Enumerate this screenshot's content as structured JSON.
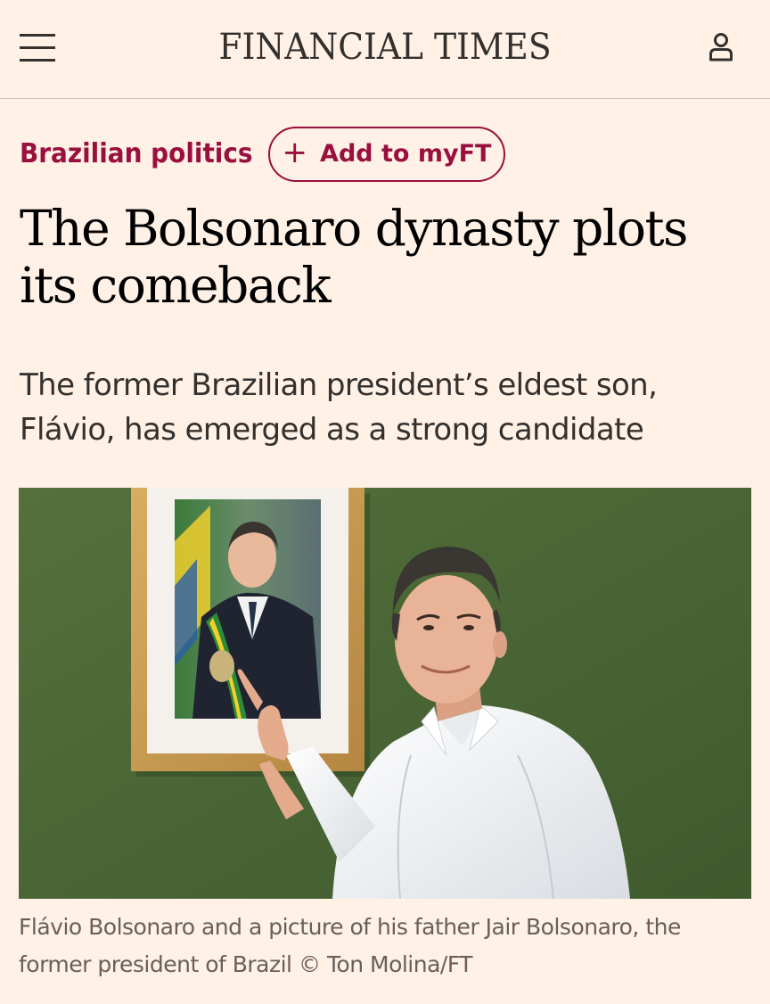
{
  "header": {
    "brand": "FINANCIAL TIMES",
    "menu_icon": "hamburger-menu-icon",
    "account_icon": "user-account-icon"
  },
  "article": {
    "topic": "Brazilian politics",
    "follow_button": {
      "icon": "plus-icon",
      "label": "Add to myFT"
    },
    "headline": "The Bolsonaro dynasty plots its comeback",
    "standfirst": "The former Brazilian president’s eldest son, Flávio, has emerged as a strong candidate",
    "image_caption": "Flávio Bolsonaro and a picture of his father Jair Bolsonaro, the former president of Brazil © Ton Molina/FT"
  },
  "colors": {
    "page_background": "#fff1e5",
    "brand_text": "#33302e",
    "topic_accent": "#990f3d",
    "headline_text": "#000000",
    "standfirst_text": "#33302e",
    "caption_text": "#66605c",
    "photo_wall_green": "#4c6536"
  }
}
